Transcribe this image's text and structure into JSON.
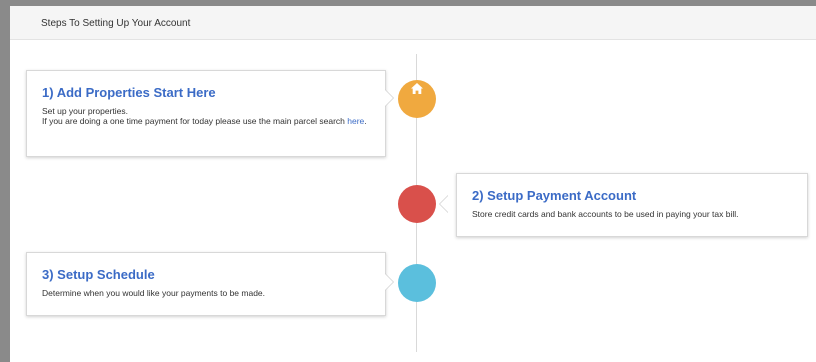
{
  "panel": {
    "title": "Steps To Setting Up Your Account"
  },
  "steps": [
    {
      "title": "1) Add Properties Start Here",
      "line1": "Set up your properties.",
      "line2_prefix": "If you are doing a one time payment for today please use the main parcel search ",
      "line2_link": "here",
      "line2_suffix": ".",
      "icon": "home-icon",
      "color": "#f0a93f"
    },
    {
      "title": "2) Setup Payment Account",
      "line1": "Store credit cards and bank accounts to be used in paying your tax bill.",
      "color": "#d9504b"
    },
    {
      "title": "3) Setup Schedule",
      "line1": "Determine when you would like your payments to be made.",
      "color": "#5bbfdd"
    }
  ]
}
